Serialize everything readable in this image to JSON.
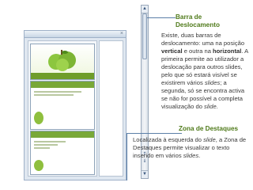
{
  "barra": {
    "title_line1": "Barra de",
    "title_line2": "Deslocamento",
    "p1": "Existe, duas barras de deslocamento: uma na posição ",
    "p1_bold": "vertical",
    "p2": " e outra na ",
    "p2_bold": "horizontal",
    "p3": ". A primeira permite ao utilizador a deslocação para outros slides, pelo que só estará visível se existirem vários ",
    "p3_em": "slides",
    "p4": "; a segunda, só se encontra activa se não for possível a completa visualização do ",
    "p4_em": "slide",
    "p5": "."
  },
  "zona": {
    "title": "Zona de Destaques",
    "p1": "Localizada à esquerda do ",
    "p1_em": "slide",
    "p2": ", a Zona de Destaques permite visualizar o texto inserido em vários ",
    "p2_em": "slides",
    "p3": "."
  },
  "icons": {
    "panel_close": "×",
    "scroll_up": "▲",
    "scroll_down": "▼",
    "prev_slide": "⇑",
    "next_slide": "⇓"
  },
  "colors": {
    "heading_green": "#4f7a1a",
    "connector_blue": "#5b7fa8",
    "slide_green": "#79a838"
  }
}
